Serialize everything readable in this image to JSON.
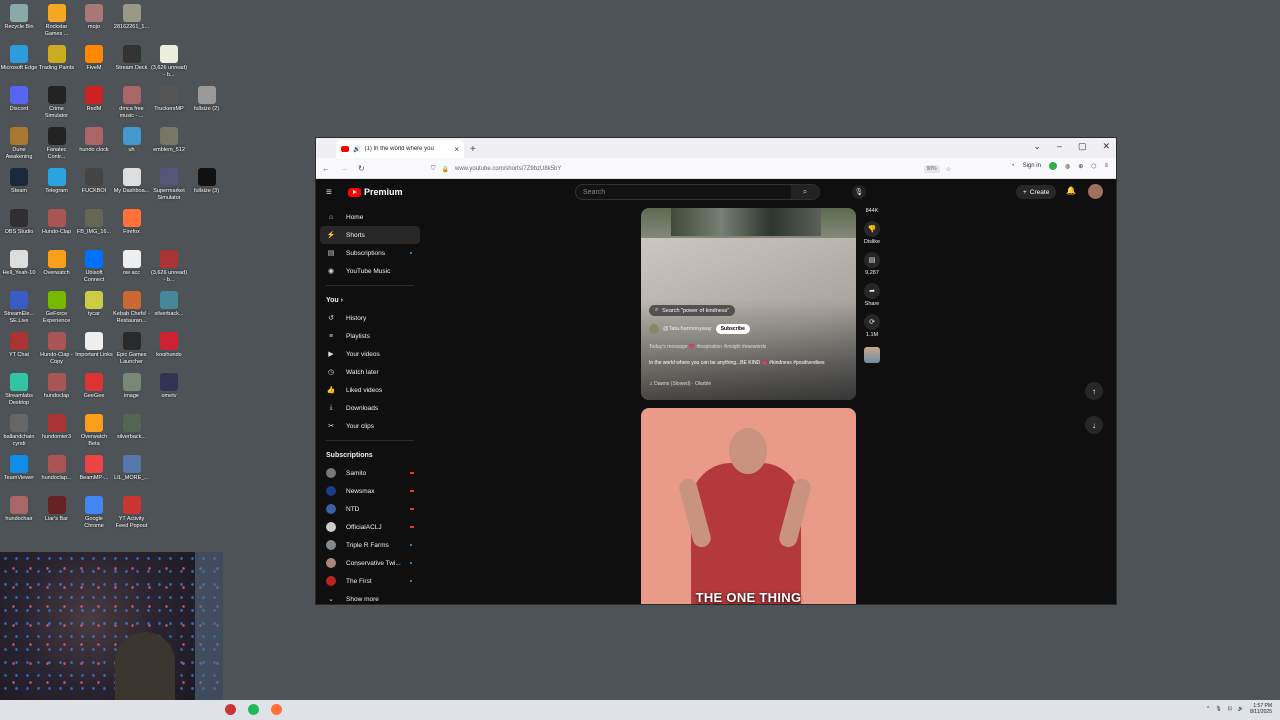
{
  "desktop": {
    "icons": [
      {
        "label": "Recycle Bin",
        "color": "#8aa"
      },
      {
        "label": "Rockstar Games ...",
        "color": "#f5a623"
      },
      {
        "label": "mojo",
        "color": "#a77"
      },
      {
        "label": "28162261_1...",
        "color": "#998"
      },
      {
        "label": "Microsoft Edge",
        "color": "#2d9cdb"
      },
      {
        "label": "Trading Paints",
        "color": "#ca2"
      },
      {
        "label": "FiveM",
        "color": "#f80"
      },
      {
        "label": "Stream Deck",
        "color": "#333"
      },
      {
        "label": "(3,626 unread) - b...",
        "color": "#eed"
      },
      {
        "label": "Discord",
        "color": "#5865f2"
      },
      {
        "label": "Crime Simulator",
        "color": "#222"
      },
      {
        "label": "RedM",
        "color": "#c22"
      },
      {
        "label": "dmca free music - ...",
        "color": "#a66"
      },
      {
        "label": "TruckersMP",
        "color": "#555"
      },
      {
        "label": "fullsize (2)",
        "color": "#999"
      },
      {
        "label": "Dune Awakening",
        "color": "#a73"
      },
      {
        "label": "Fanatec Contr...",
        "color": "#222"
      },
      {
        "label": "hundo clock",
        "color": "#a66"
      },
      {
        "label": "uh",
        "color": "#49c"
      },
      {
        "label": "emblem_512",
        "color": "#776"
      },
      {
        "label": "Steam",
        "color": "#1b2838"
      },
      {
        "label": "Telegram",
        "color": "#2aa3e0"
      },
      {
        "label": "FUCKBOI",
        "color": "#444"
      },
      {
        "label": "My Dashboa...",
        "color": "#ddd"
      },
      {
        "label": "Supermarket Simulator",
        "color": "#557"
      },
      {
        "label": "fullsize (3)",
        "color": "#111"
      },
      {
        "label": "OBS Studio",
        "color": "#302e31"
      },
      {
        "label": "Hundo-Clap",
        "color": "#a55"
      },
      {
        "label": "FB_IMG_16...",
        "color": "#665"
      },
      {
        "label": "Firefox",
        "color": "#ff7139"
      },
      {
        "label": "Hell_Yeah-10",
        "color": "#ddd"
      },
      {
        "label": "Overwatch",
        "color": "#f99e1a"
      },
      {
        "label": "Ubisoft Connect",
        "color": "#0070ff"
      },
      {
        "label": "ow acc",
        "color": "#eee"
      },
      {
        "label": "(3,626 unread) - b...",
        "color": "#a33"
      },
      {
        "label": "StreamEle... SE.Live",
        "color": "#3a5cc7"
      },
      {
        "label": "GeForce Experience",
        "color": "#76b900"
      },
      {
        "label": "tycar",
        "color": "#cc4"
      },
      {
        "label": "Kebab Chefs! - Restauran...",
        "color": "#c63"
      },
      {
        "label": "silverback...",
        "color": "#489"
      },
      {
        "label": "YT Chat",
        "color": "#a33"
      },
      {
        "label": "Hundo-Clap - Copy",
        "color": "#a55"
      },
      {
        "label": "Important Links",
        "color": "#eee"
      },
      {
        "label": "Epic Games Launcher",
        "color": "#2a2a2a"
      },
      {
        "label": "kooihundo",
        "color": "#c23"
      },
      {
        "label": "Streamlabs Desktop",
        "color": "#31c3a2"
      },
      {
        "label": "hundoclap",
        "color": "#a55"
      },
      {
        "label": "GeeGee",
        "color": "#d33"
      },
      {
        "label": "image",
        "color": "#787"
      },
      {
        "label": "ometv",
        "color": "#335"
      },
      {
        "label": "ballandchain cyndi",
        "color": "#666"
      },
      {
        "label": "hundomier3",
        "color": "#a33"
      },
      {
        "label": "Overwatch Beta",
        "color": "#f99e1a"
      },
      {
        "label": "silverback...",
        "color": "#565"
      },
      {
        "label": "TeamViewer",
        "color": "#0e8ee9"
      },
      {
        "label": "hundoclap...",
        "color": "#a55"
      },
      {
        "label": "BeamMP-...",
        "color": "#e44"
      },
      {
        "label": "LIL_MORE_...",
        "color": "#57a"
      },
      {
        "label": "hundochair",
        "color": "#a66"
      },
      {
        "label": "Liar's Bar",
        "color": "#622"
      },
      {
        "label": "Google Chrome",
        "color": "#4285f4"
      },
      {
        "label": "YT Activity Feed Popout",
        "color": "#c33"
      }
    ]
  },
  "browser": {
    "tab_title": "(1) In the world where you",
    "new_tab": "+",
    "url": "www.youtube.com/shorts/7Z9bzU8k5bY",
    "zoom": "90%",
    "sign_in": "Sign in"
  },
  "youtube": {
    "logo": "Premium",
    "search_placeholder": "Search",
    "create": "Create",
    "sidebar": {
      "main": [
        {
          "label": "Home",
          "icon": "⌂"
        },
        {
          "label": "Shorts",
          "icon": "⚡"
        },
        {
          "label": "Subscriptions",
          "icon": "▤"
        },
        {
          "label": "YouTube Music",
          "icon": "◉"
        }
      ],
      "you_header": "You",
      "you": [
        {
          "label": "History",
          "icon": "↺"
        },
        {
          "label": "Playlists",
          "icon": "≡"
        },
        {
          "label": "Your videos",
          "icon": "▶"
        },
        {
          "label": "Watch later",
          "icon": "◷"
        },
        {
          "label": "Liked videos",
          "icon": "👍"
        },
        {
          "label": "Downloads",
          "icon": "⤓"
        },
        {
          "label": "Your clips",
          "icon": "✂"
        }
      ],
      "subs_header": "Subscriptions",
      "subs": [
        {
          "label": "Samito",
          "color": "#777"
        },
        {
          "label": "Newsmax",
          "color": "#1c3d8c"
        },
        {
          "label": "NTD",
          "color": "#3b5ea8"
        },
        {
          "label": "OfficialACLJ",
          "color": "#ccc"
        },
        {
          "label": "Triple R Farms",
          "color": "#888"
        },
        {
          "label": "Conservative Twi...",
          "color": "#a87"
        },
        {
          "label": "The First",
          "color": "#b22"
        }
      ],
      "show_more": "Show more"
    },
    "short1": {
      "search_pill": "Search \"power of kindness\"",
      "channel": "@Tata.harmonyway",
      "subscribe": "Subscribe",
      "message": "Today's message 💗 #inspiration #insight #esewords",
      "description": "In the world where you can be anything...BE KIND 💗 #kindness #positivevibes",
      "music": "♫ Dawns (Slowed) · Olarble"
    },
    "short2": {
      "caption": "THE ONE THING"
    },
    "actions": {
      "likes": "844K",
      "dislike": "Dislike",
      "comments": "9,287",
      "share": "Share",
      "remix": "1.1M"
    }
  },
  "taskbar": {
    "time": "1:57 PM",
    "date": "8/11/2025"
  }
}
